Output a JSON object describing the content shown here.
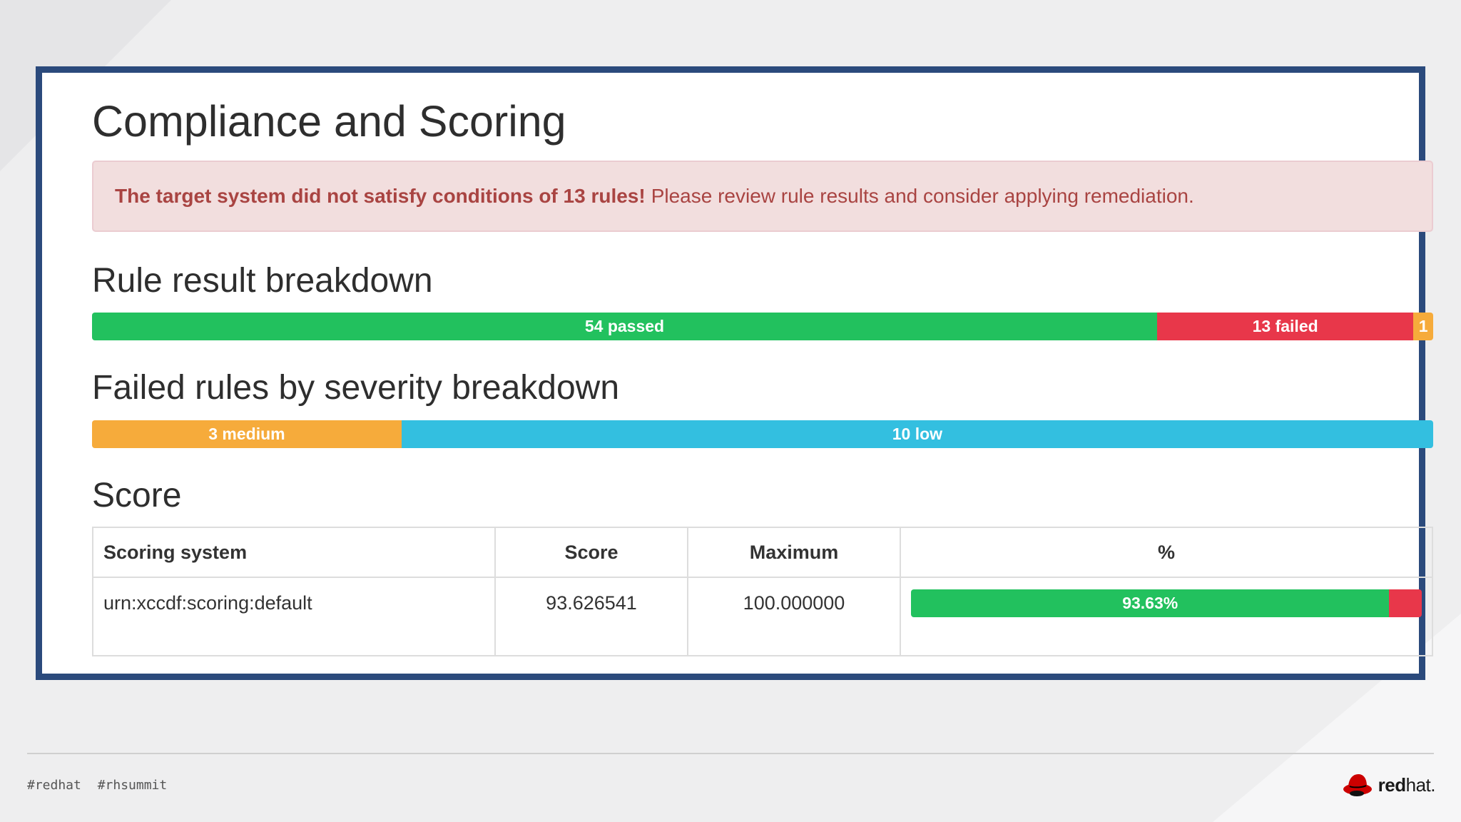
{
  "slide": {
    "title": "Compliance and Scoring",
    "alert": {
      "bold": "The target system did not satisfy conditions of 13 rules!",
      "text": "Please review rule results and consider applying remediation."
    },
    "rule_result": {
      "heading": "Rule result breakdown",
      "segments": [
        {
          "label": "54 passed",
          "value": 54,
          "color": "#22c15e"
        },
        {
          "label": "13 failed",
          "value": 13,
          "color": "#e8374a"
        },
        {
          "label": "1",
          "value": 1,
          "color": "#f6ab3b"
        }
      ]
    },
    "severity": {
      "heading": "Failed rules by severity breakdown",
      "segments": [
        {
          "label": "3 medium",
          "value": 3,
          "color": "#f6ab3b"
        },
        {
          "label": "10 low",
          "value": 10,
          "color": "#33bfe0"
        }
      ]
    },
    "score": {
      "heading": "Score",
      "columns": [
        "Scoring system",
        "Score",
        "Maximum",
        "%"
      ],
      "rows": [
        {
          "system": "urn:xccdf:scoring:default",
          "score": "93.626541",
          "maximum": "100.000000",
          "percent_label": "93.63%",
          "percent_value": 93.63
        }
      ]
    }
  },
  "footer": {
    "hashtags": [
      "#redhat",
      "#rhsummit"
    ],
    "logo_bold": "red",
    "logo_light": "hat."
  },
  "colors": {
    "frame": "#2b4a7c",
    "pass": "#22c15e",
    "fail": "#e8374a",
    "medium": "#f6ab3b",
    "low": "#33bfe0",
    "alert_bg": "#f2dede",
    "alert_text": "#a94442"
  }
}
